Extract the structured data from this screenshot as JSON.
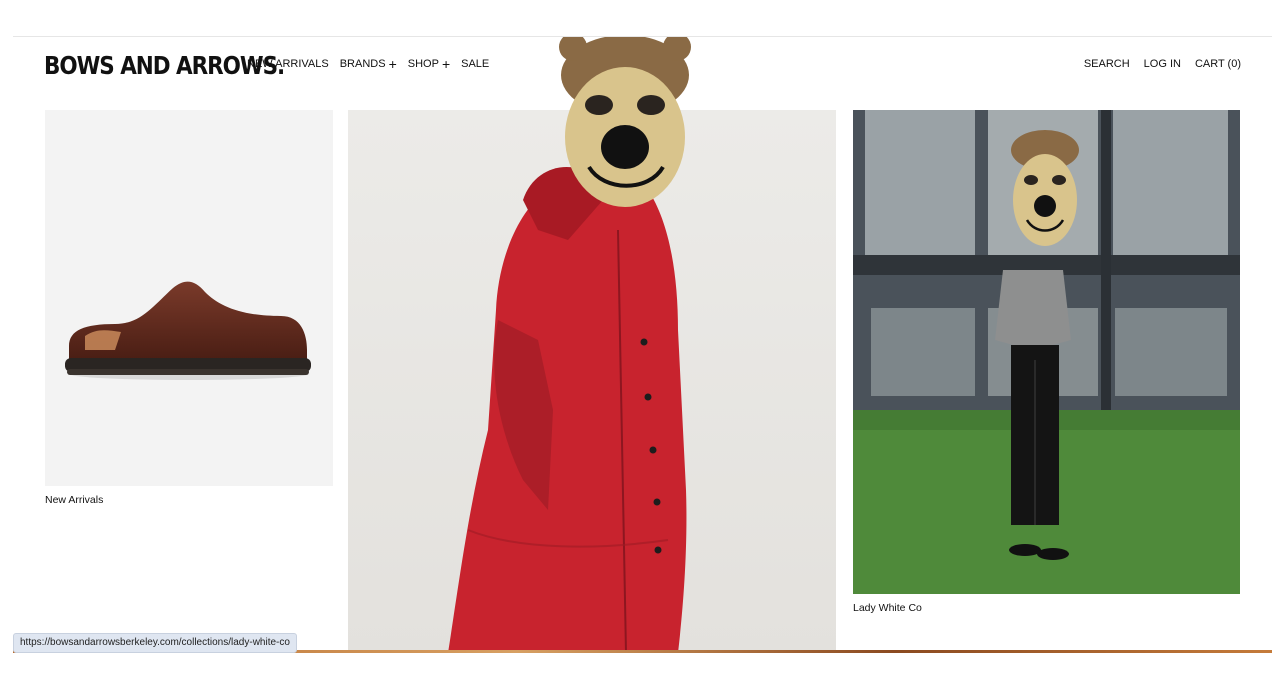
{
  "header": {
    "logo": "BOWS AND ARROWS.",
    "nav": [
      {
        "label": "NEW ARRIVALS",
        "has_plus": false
      },
      {
        "label": "BRANDS",
        "has_plus": true
      },
      {
        "label": "SHOP",
        "has_plus": true
      },
      {
        "label": "SALE",
        "has_plus": false
      }
    ],
    "plus_glyph": "+",
    "search": "SEARCH",
    "login": "LOG IN",
    "cart": "CART (0)"
  },
  "tiles": [
    {
      "id": "new-arrivals",
      "caption": "New Arrivals",
      "image": "brown-leather-clog"
    },
    {
      "id": "red-coat",
      "caption": "",
      "image": "model-red-coat"
    },
    {
      "id": "lady-white-co",
      "caption": "Lady White Co",
      "image": "model-grey-tee-lawn"
    }
  ],
  "status_bar": {
    "url": "https://bowsandarrowsberkeley.com/collections/lady-white-co"
  },
  "colors": {
    "accent": "#111111",
    "coat_red": "#c8232e",
    "status_bg": "#dfe6f1"
  }
}
